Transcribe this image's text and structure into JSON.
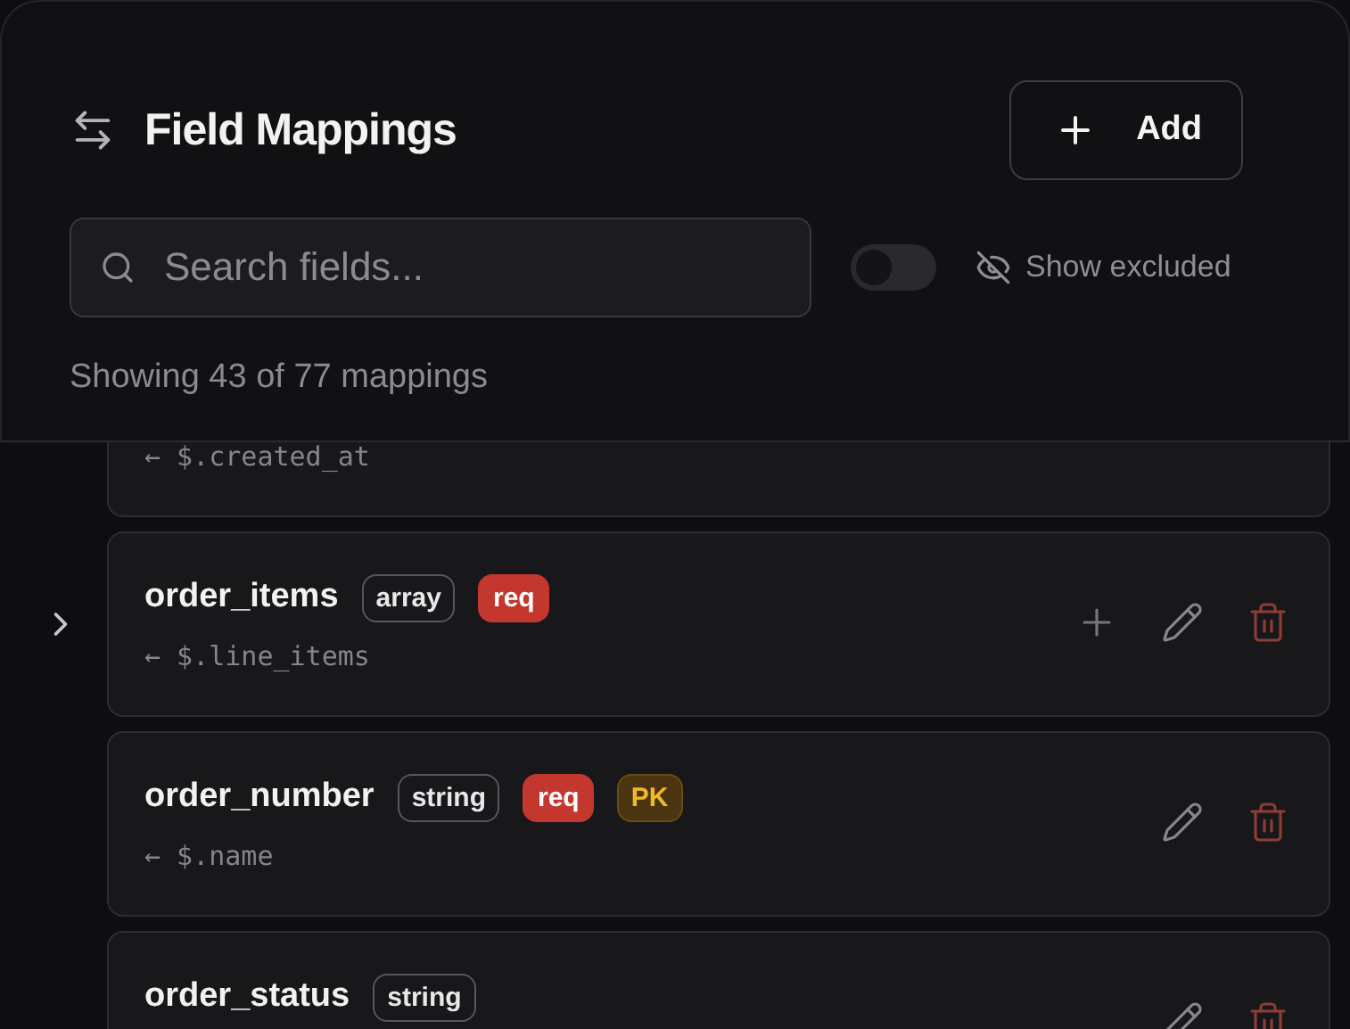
{
  "header": {
    "title": "Field Mappings",
    "add_button": "Add"
  },
  "search": {
    "placeholder": "Search fields..."
  },
  "show_excluded": {
    "label": "Show excluded",
    "on": false
  },
  "summary": "Showing 43 of 77 mappings",
  "mappings": [
    {
      "source": "← $.created_at"
    },
    {
      "name": "order_items",
      "source": "← $.line_items",
      "badges": [
        {
          "label": "array",
          "kind": "type"
        },
        {
          "label": "req",
          "kind": "required"
        }
      ],
      "expandable": true,
      "can_add": true
    },
    {
      "name": "order_number",
      "source": "← $.name",
      "badges": [
        {
          "label": "string",
          "kind": "type"
        },
        {
          "label": "req",
          "kind": "required"
        },
        {
          "label": "PK",
          "kind": "key"
        }
      ],
      "expandable": false,
      "can_add": false
    },
    {
      "name": "order_status",
      "badges": [
        {
          "label": "string",
          "kind": "type"
        }
      ],
      "expandable": false,
      "can_add": false
    }
  ]
}
